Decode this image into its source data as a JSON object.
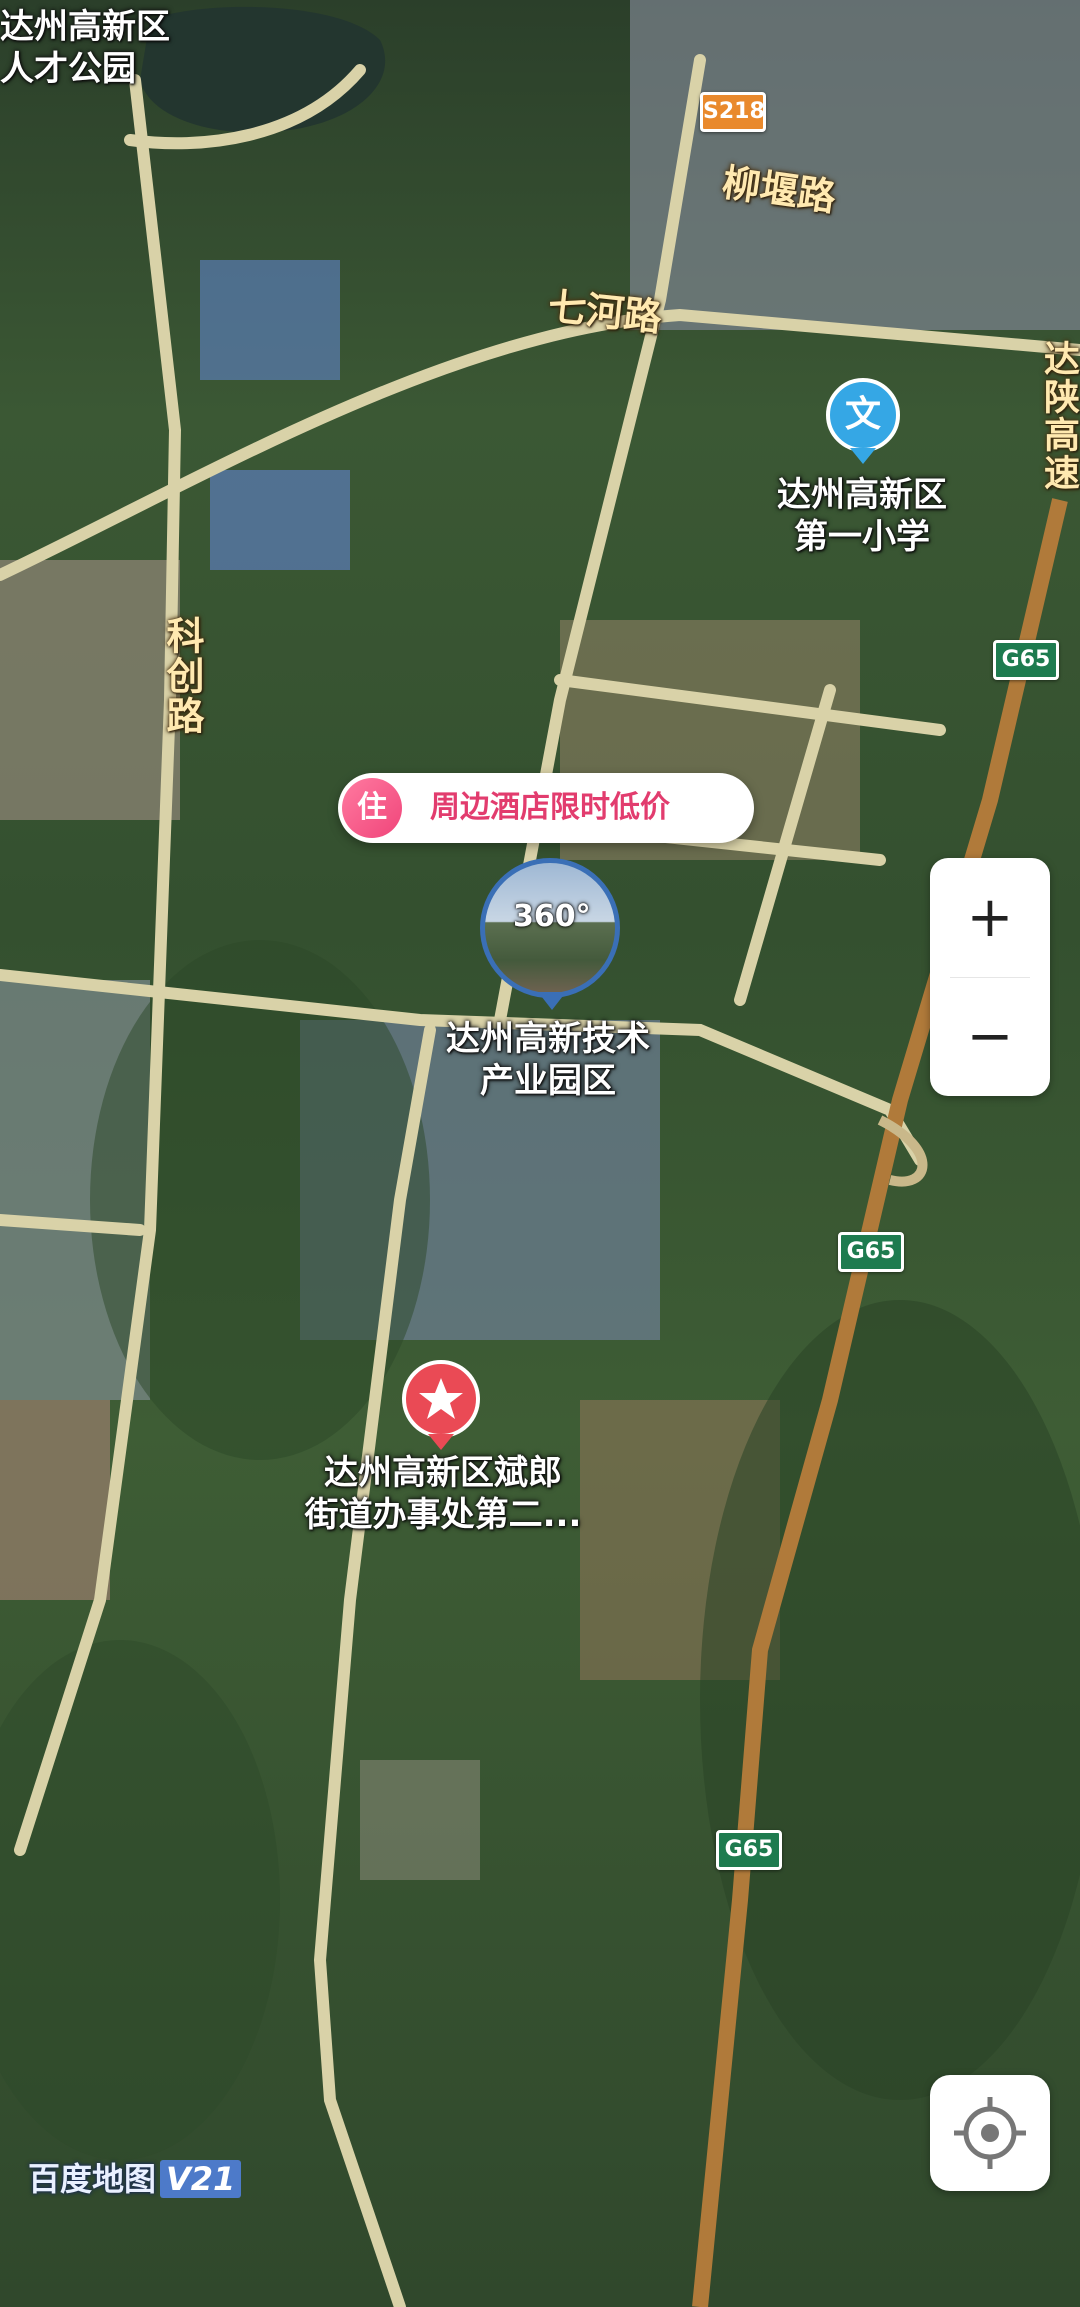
{
  "map": {
    "labels": {
      "park": "达州高新区\n人才公园",
      "school": "达州高新区\n第一小学",
      "industrial_park": "达州高新技术\n产业园区",
      "office": "达州高新区斌郎\n街道办事处第二..."
    },
    "roads": {
      "liuyan": "柳堰路",
      "qihe": "七河路",
      "kechuang": "科创路",
      "expressway_fragment": "达陕高速"
    },
    "shields": {
      "s218": "S218",
      "g65": "G65"
    },
    "panorama": {
      "label": "360°"
    },
    "promo": {
      "icon": "住",
      "text": "周边酒店限时低价"
    },
    "controls": {
      "zoom_in": "+",
      "zoom_out": "−"
    },
    "watermark": {
      "brand": "百度地图",
      "version": "V21"
    },
    "colors": {
      "expressway": "#b07a3a",
      "road": "#d9d2a8",
      "school_pin": "#35a7e5",
      "poi_pin": "#ea4a55",
      "promo_accent": "#e23c6e"
    }
  }
}
